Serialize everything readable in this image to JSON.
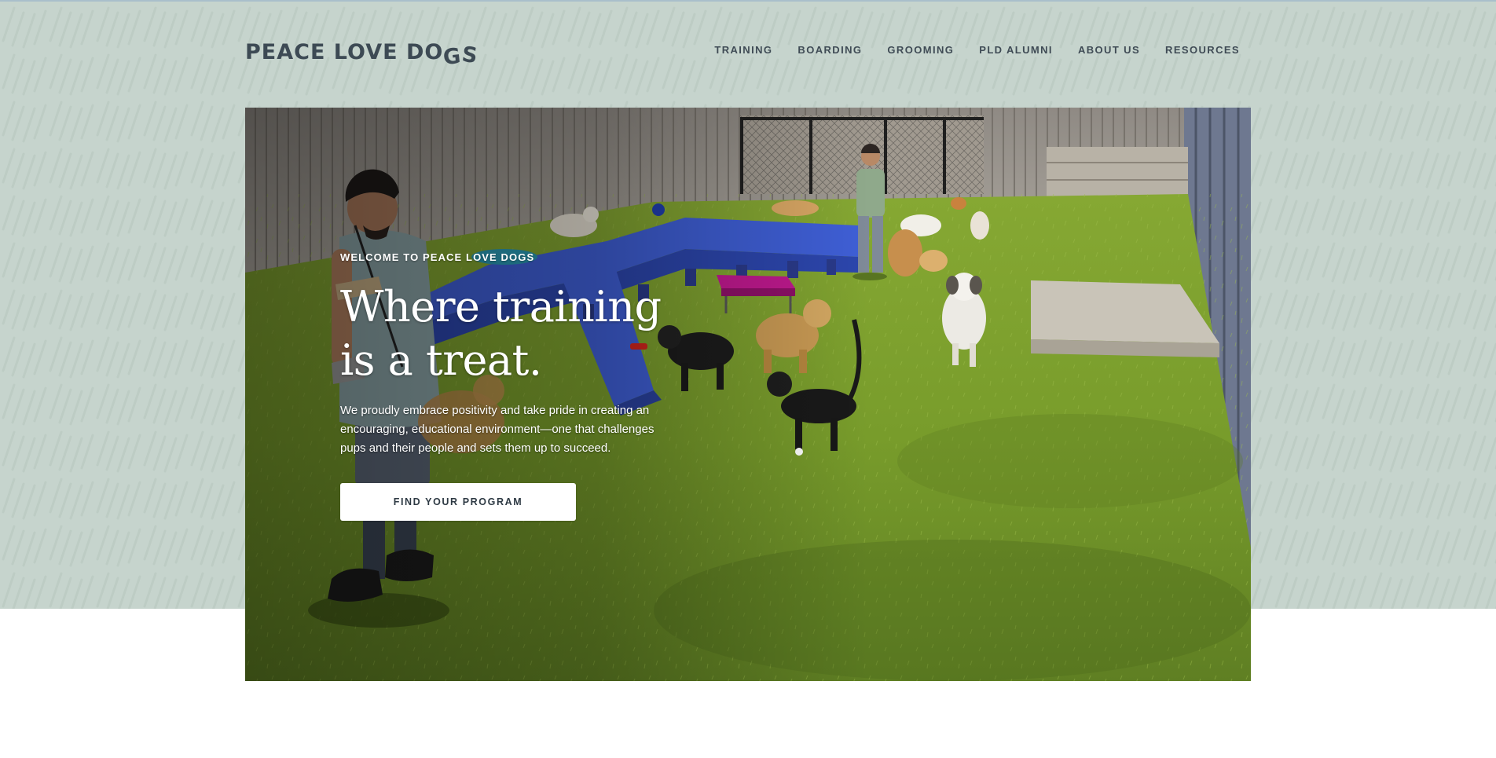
{
  "brand": {
    "logo_text_part1": "PEACE LOVE DO",
    "logo_text_g": "G",
    "logo_text_s": "S"
  },
  "nav": {
    "items": [
      {
        "label": "TRAINING"
      },
      {
        "label": "BOARDING"
      },
      {
        "label": "GROOMING"
      },
      {
        "label": "PLD ALUMNI"
      },
      {
        "label": "ABOUT US"
      },
      {
        "label": "RESOURCES"
      }
    ]
  },
  "hero": {
    "eyebrow": "WELCOME TO PEACE LOVE DOGS",
    "headline_line1": "Where training",
    "headline_line2": "is a treat.",
    "intro": "We proudly embrace positivity and take pride in creating an encouraging, educational environment—one that challenges pups and their people and sets them up to succeed.",
    "cta_label": "FIND YOUR PROGRAM"
  },
  "colors": {
    "band_background": "#c6d4cd",
    "text_dark": "#3d4a54",
    "cta_background": "#ffffff",
    "grass": "#7ea12e",
    "ramp_blue": "#3f5fd6",
    "table_magenta": "#c0198f"
  }
}
